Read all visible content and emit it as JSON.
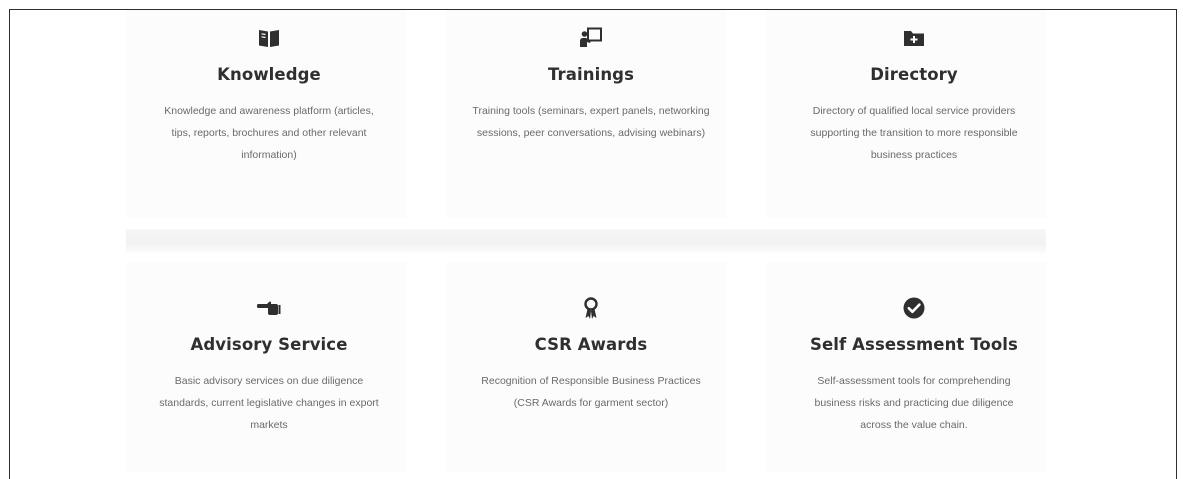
{
  "services": [
    {
      "title": "Knowledge",
      "description": "Knowledge and awareness platform (articles, tips, reports, brochures and other relevant information)",
      "icon": "book-icon"
    },
    {
      "title": "Trainings",
      "description": "Training tools (seminars, expert panels, networking sessions, peer conversations, advising webinars)",
      "icon": "presentation-icon"
    },
    {
      "title": "Directory",
      "description": "Directory of qualified local service providers supporting the transition to more responsible business practices",
      "icon": "folder-plus-icon"
    },
    {
      "title": "Advisory Service",
      "description": "Basic advisory services on due diligence standards, current legislative changes in export markets",
      "icon": "hand-pointing-icon"
    },
    {
      "title": "CSR Awards",
      "description": "Recognition of Responsible Business Practices (CSR Awards for garment sector)",
      "icon": "award-icon"
    },
    {
      "title": "Self Assessment Tools",
      "description": "Self-assessment tools for comprehending business risks and practicing due diligence across the value chain.",
      "icon": "check-circle-icon"
    }
  ],
  "colors": {
    "title": "#2f2f2f",
    "text": "#6a6a6a",
    "icon": "#2f2f2f"
  }
}
